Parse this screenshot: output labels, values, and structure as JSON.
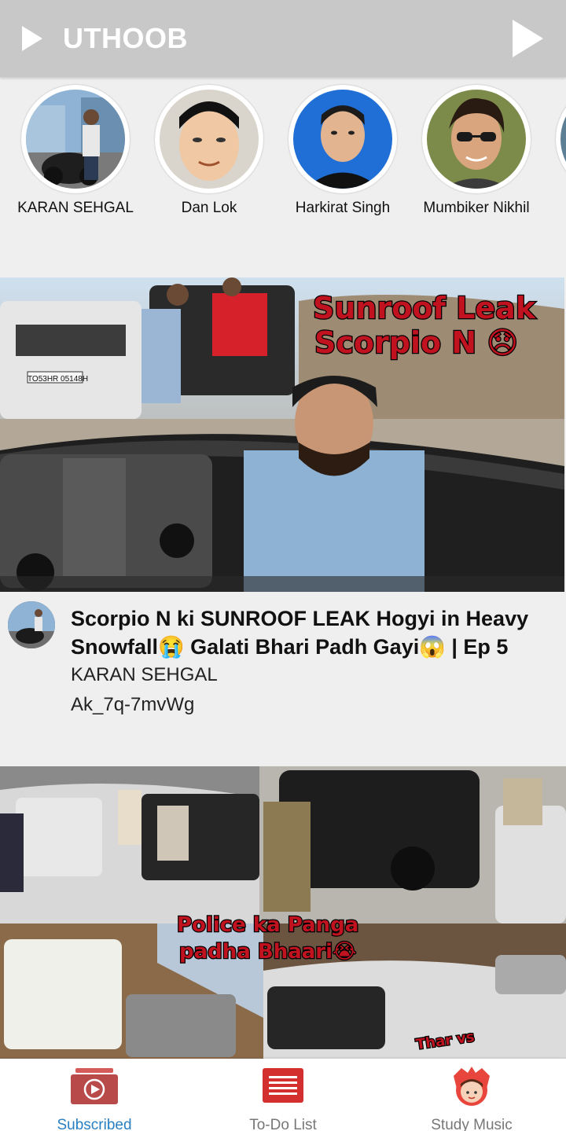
{
  "header": {
    "title": "UTHOOB"
  },
  "channels": [
    {
      "name": "KARAN SEHGAL"
    },
    {
      "name": "Dan Lok"
    },
    {
      "name": "Harkirat Singh"
    },
    {
      "name": "Mumbiker Nikhil"
    }
  ],
  "videos": [
    {
      "thumbnail_text": [
        "Sunroof Leak",
        "Scorpio N 😞"
      ],
      "plate_text": "TO53HR 05148H",
      "title": "Scorpio N ki SUNROOF LEAK Hogyi in Heavy Snowfall😭 Galati Bhari Padh Gayi😱 | Ep 5",
      "channel": "KARAN SEHGAL",
      "video_id": "Ak_7q-7mvWg"
    },
    {
      "thumbnail_text": [
        "Police ka Panga",
        "padha Bhaari😭"
      ],
      "corner_text": "Thar vs"
    }
  ],
  "bottom_nav": [
    {
      "label": "Subscribed",
      "icon": "subscribed-icon",
      "active": true
    },
    {
      "label": "To-Do List",
      "icon": "todo-list-icon",
      "active": false
    },
    {
      "label": "Study Music",
      "icon": "study-music-icon",
      "active": false
    }
  ],
  "colors": {
    "header_bg": "#c8c8c8",
    "active_tab": "#2a7fc0",
    "accent_red": "#d32f2f"
  }
}
